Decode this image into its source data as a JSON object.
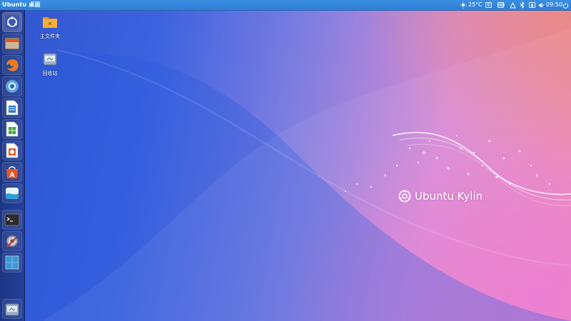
{
  "panel": {
    "title": "Ubuntu 桌面",
    "weather": "25°C",
    "time": "09:50",
    "tray_icons": [
      "input-method-icon",
      "keyboard-icon",
      "network-icon",
      "bluetooth-icon",
      "battery-icon",
      "volume-icon",
      "power-icon"
    ]
  },
  "launcher": {
    "items": [
      {
        "name": "dash-home",
        "icon": "ubuntu-logo-icon"
      },
      {
        "name": "files",
        "icon": "file-manager-icon"
      },
      {
        "name": "firefox",
        "icon": "firefox-icon"
      },
      {
        "name": "chromium",
        "icon": "browser-icon"
      },
      {
        "name": "writer",
        "icon": "libreoffice-writer-icon"
      },
      {
        "name": "calc",
        "icon": "libreoffice-calc-icon"
      },
      {
        "name": "impress",
        "icon": "libreoffice-impress-icon"
      },
      {
        "name": "software-center",
        "icon": "software-center-icon"
      },
      {
        "name": "kylin-assistant",
        "icon": "assistant-icon"
      },
      {
        "name": "terminal",
        "icon": "terminal-icon"
      },
      {
        "name": "system-settings",
        "icon": "settings-icon"
      },
      {
        "name": "workspace",
        "icon": "workspace-icon"
      },
      {
        "name": "trash",
        "icon": "trash-icon"
      }
    ]
  },
  "desktop": {
    "icons": [
      {
        "label": "主文件夹",
        "icon": "home-folder-icon"
      },
      {
        "label": "回收站",
        "icon": "trash-icon"
      }
    ],
    "logo_text": "Ubuntu Kylin"
  },
  "colors": {
    "panel": "#2f7fd6",
    "launcher": "#1d3585",
    "accent": "#e95420"
  }
}
